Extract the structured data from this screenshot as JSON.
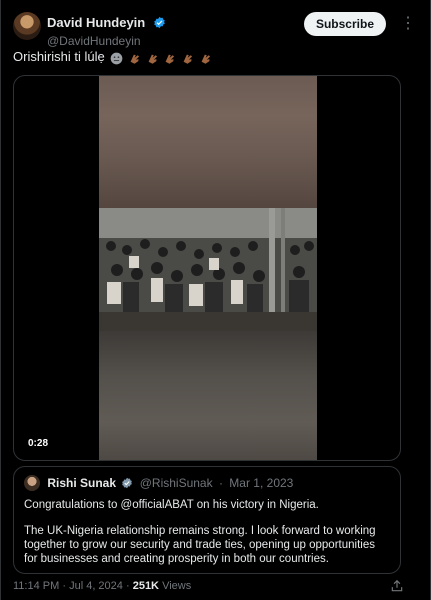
{
  "author": {
    "display_name": "David Hundeyin",
    "handle": "@DavidHundeyin",
    "verified_icon": "verified-badge-icon"
  },
  "actions": {
    "subscribe_label": "Subscribe",
    "more_label": "⋮"
  },
  "tweet": {
    "text": "Orishirishi ti lúlẹ",
    "emojis": [
      "😐",
      "👏🏽",
      "👏🏽",
      "👏🏽",
      "👏🏽",
      "👏🏽"
    ]
  },
  "media": {
    "duration": "0:28"
  },
  "quoted_tweet": {
    "display_name": "Rishi Sunak",
    "handle": "@RishiSunak",
    "separator": "·",
    "date": "Mar 1, 2023",
    "paragraphs": [
      "Congratulations to @officialABAT on his victory in Nigeria.",
      "The UK-Nigeria relationship remains strong. I look forward to working together to grow our security and trade ties, opening up opportunities for businesses and creating prosperity in both our countries."
    ]
  },
  "footer": {
    "time": "11:14 PM",
    "separator": "·",
    "date": "Jul 4, 2024",
    "views_count": "251K",
    "views_label": "Views"
  },
  "colors": {
    "background": "#000000",
    "text": "#e7e9ea",
    "muted": "#71767b",
    "verified": "#1d9bf0",
    "border": "#2f3336"
  }
}
